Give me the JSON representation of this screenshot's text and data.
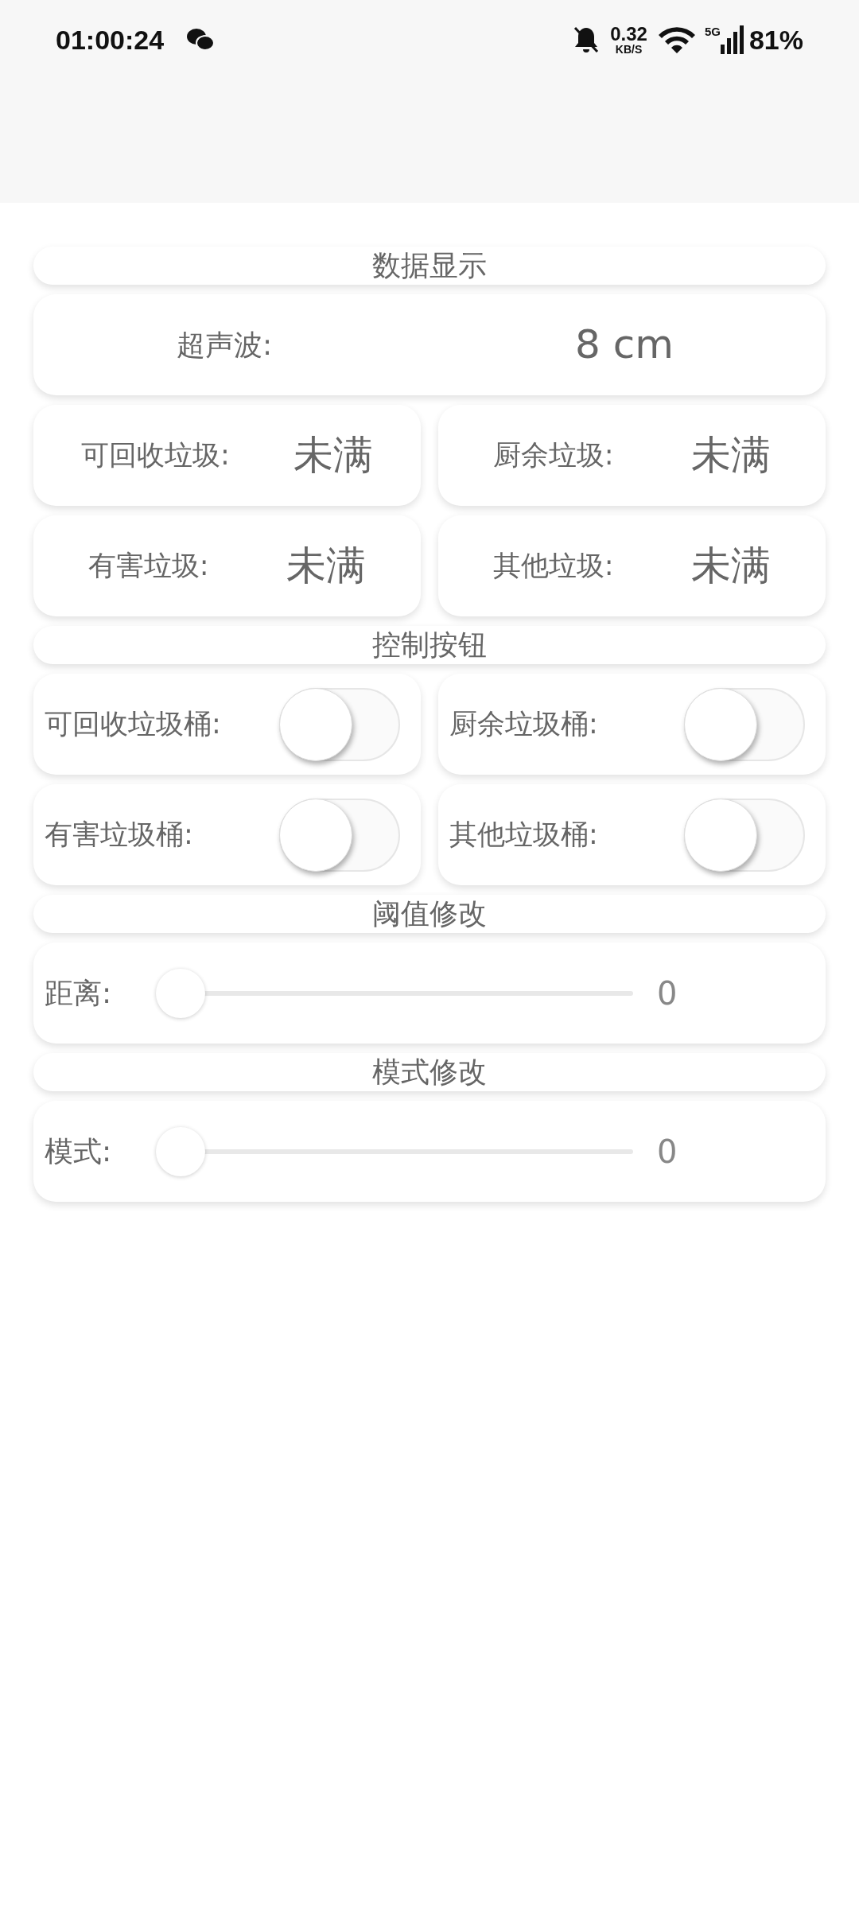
{
  "status_bar": {
    "time": "01:00:24",
    "net_speed": "0.32",
    "net_unit": "KB/S",
    "network": "5G",
    "battery": "81%"
  },
  "data_section": {
    "title": "数据显示",
    "ultrasonic": {
      "label": "超声波:",
      "value": "8 cm"
    },
    "bins": [
      {
        "label": "可回收垃圾:",
        "value": "未满"
      },
      {
        "label": "厨余垃圾:",
        "value": "未满"
      },
      {
        "label": "有害垃圾:",
        "value": "未满"
      },
      {
        "label": "其他垃圾:",
        "value": "未满"
      }
    ]
  },
  "control_section": {
    "title": "控制按钮",
    "switches": [
      {
        "label": "可回收垃圾桶:",
        "on": false
      },
      {
        "label": "厨余垃圾桶:",
        "on": false
      },
      {
        "label": "有害垃圾桶:",
        "on": false
      },
      {
        "label": "其他垃圾桶:",
        "on": false
      }
    ]
  },
  "threshold_section": {
    "title": "阈值修改",
    "slider": {
      "label": "距离:",
      "level": 0,
      "reading": "0"
    }
  },
  "mode_section": {
    "title": "模式修改",
    "slider": {
      "label": "模式:",
      "level": 0,
      "reading": "0"
    }
  }
}
